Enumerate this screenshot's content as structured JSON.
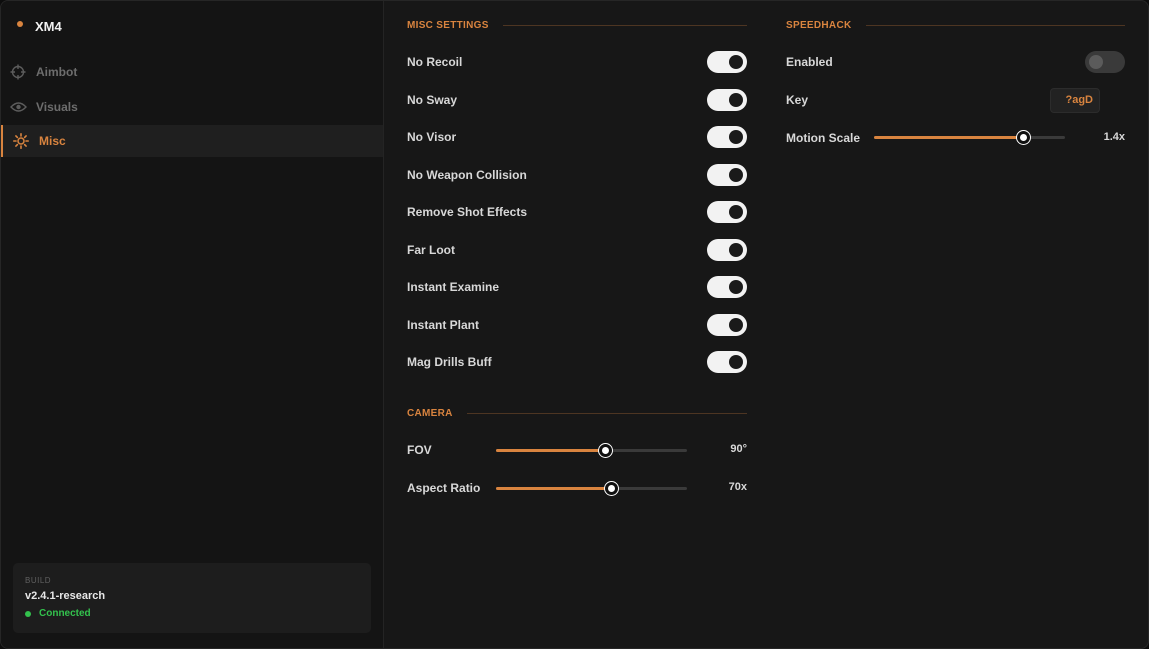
{
  "app": {
    "title": "XM4"
  },
  "colors": {
    "accent": "#d9843f",
    "connected": "#33c24d"
  },
  "nav": [
    {
      "label": "Aimbot",
      "icon": "crosshair-icon",
      "active": false
    },
    {
      "label": "Visuals",
      "icon": "eye-icon",
      "active": false
    },
    {
      "label": "Misc",
      "icon": "gear-icon",
      "active": true
    }
  ],
  "build": {
    "tag": "BUILD",
    "version": "v2.4.1-research",
    "status": "Connected"
  },
  "misc": {
    "title": "MISC SETTINGS",
    "toggles": [
      {
        "label": "No Recoil",
        "on": true
      },
      {
        "label": "No Sway",
        "on": true
      },
      {
        "label": "No Visor",
        "on": true
      },
      {
        "label": "No Weapon Collision",
        "on": true
      },
      {
        "label": "Remove Shot Effects",
        "on": true
      },
      {
        "label": "Far Loot",
        "on": true
      },
      {
        "label": "Instant Examine",
        "on": true
      },
      {
        "label": "Instant Plant",
        "on": true
      },
      {
        "label": "Mag Drills Buff",
        "on": true
      }
    ]
  },
  "camera": {
    "title": "CAMERA",
    "sliders": [
      {
        "label": "FOV",
        "value": "90°",
        "fraction": 0.57
      },
      {
        "label": "Aspect Ratio",
        "value": "70x",
        "fraction": 0.6
      }
    ]
  },
  "speedhack": {
    "title": "SPEEDHACK",
    "enabled_label": "Enabled",
    "enabled": false,
    "key_label": "Key",
    "key_value": "?agD",
    "motion_label": "Motion Scale",
    "motion_value": "1.4x",
    "motion_fraction": 0.78
  }
}
